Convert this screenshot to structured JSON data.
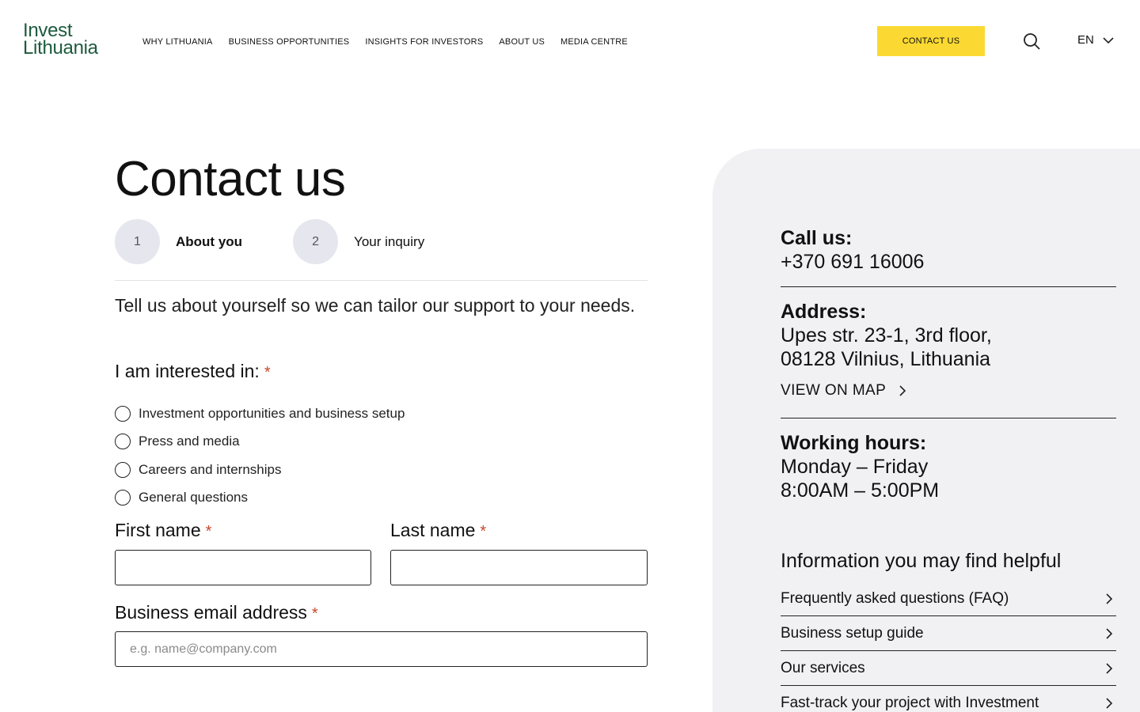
{
  "header": {
    "logo_line1": "Invest",
    "logo_line2": "Lithuania",
    "nav": [
      "WHY LITHUANIA",
      "BUSINESS OPPORTUNITIES",
      "INSIGHTS FOR INVESTORS",
      "ABOUT US",
      "MEDIA CENTRE"
    ],
    "contact_button": "CONTACT US",
    "language": "EN"
  },
  "page": {
    "title": "Contact us",
    "steps": [
      {
        "number": "1",
        "label": "About you"
      },
      {
        "number": "2",
        "label": "Your inquiry"
      }
    ],
    "intro": "Tell us about yourself so we can tailor our support to your needs.",
    "interest_label": "I am interested in:",
    "required_mark": "*",
    "interest_options": [
      "Investment opportunities and business setup",
      "Press and media",
      "Careers and internships",
      "General questions"
    ],
    "first_name_label": "First name",
    "last_name_label": "Last name",
    "email_label": "Business email address",
    "email_placeholder": "e.g. name@company.com"
  },
  "sidebar": {
    "call_label": "Call us:",
    "phone": "+370 691 16006",
    "address_label": "Address:",
    "address_line1": "Upes str. 23-1, 3rd floor,",
    "address_line2": "08128 Vilnius, Lithuania",
    "map_link": "VIEW ON MAP",
    "hours_label": "Working hours:",
    "hours_days": "Monday – Friday",
    "hours_time": "8:00AM – 5:00PM",
    "helpful_title": "Information you may find helpful",
    "helpful_links": [
      "Frequently asked questions (FAQ)",
      "Business setup guide",
      "Our services",
      "Fast-track your project with Investment"
    ]
  },
  "colors": {
    "brand_green": "#1d5a3e",
    "accent_yellow": "#fbd932",
    "required_red": "#c9472b",
    "panel_bg": "#f1f1f4"
  }
}
